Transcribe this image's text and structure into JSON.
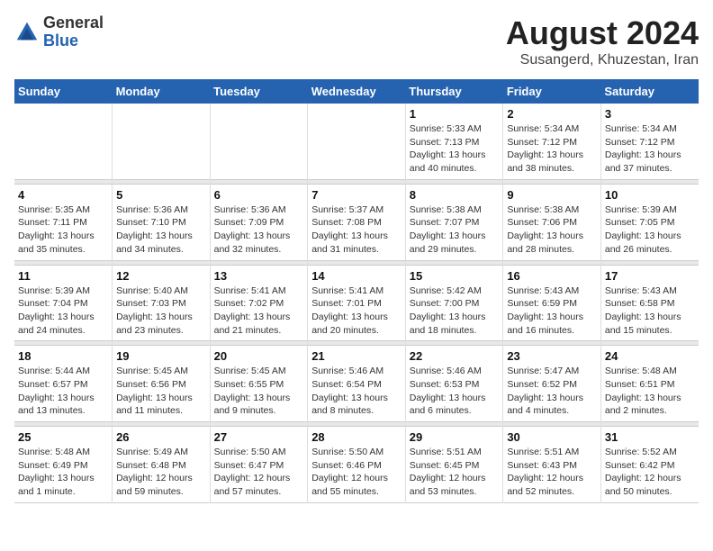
{
  "header": {
    "logo_line1": "General",
    "logo_line2": "Blue",
    "main_title": "August 2024",
    "sub_title": "Susangerd, Khuzestan, Iran"
  },
  "days_of_week": [
    "Sunday",
    "Monday",
    "Tuesday",
    "Wednesday",
    "Thursday",
    "Friday",
    "Saturday"
  ],
  "weeks": [
    {
      "cells": [
        {
          "day": "",
          "info": ""
        },
        {
          "day": "",
          "info": ""
        },
        {
          "day": "",
          "info": ""
        },
        {
          "day": "",
          "info": ""
        },
        {
          "day": "1",
          "info": "Sunrise: 5:33 AM\nSunset: 7:13 PM\nDaylight: 13 hours\nand 40 minutes."
        },
        {
          "day": "2",
          "info": "Sunrise: 5:34 AM\nSunset: 7:12 PM\nDaylight: 13 hours\nand 38 minutes."
        },
        {
          "day": "3",
          "info": "Sunrise: 5:34 AM\nSunset: 7:12 PM\nDaylight: 13 hours\nand 37 minutes."
        }
      ]
    },
    {
      "cells": [
        {
          "day": "4",
          "info": "Sunrise: 5:35 AM\nSunset: 7:11 PM\nDaylight: 13 hours\nand 35 minutes."
        },
        {
          "day": "5",
          "info": "Sunrise: 5:36 AM\nSunset: 7:10 PM\nDaylight: 13 hours\nand 34 minutes."
        },
        {
          "day": "6",
          "info": "Sunrise: 5:36 AM\nSunset: 7:09 PM\nDaylight: 13 hours\nand 32 minutes."
        },
        {
          "day": "7",
          "info": "Sunrise: 5:37 AM\nSunset: 7:08 PM\nDaylight: 13 hours\nand 31 minutes."
        },
        {
          "day": "8",
          "info": "Sunrise: 5:38 AM\nSunset: 7:07 PM\nDaylight: 13 hours\nand 29 minutes."
        },
        {
          "day": "9",
          "info": "Sunrise: 5:38 AM\nSunset: 7:06 PM\nDaylight: 13 hours\nand 28 minutes."
        },
        {
          "day": "10",
          "info": "Sunrise: 5:39 AM\nSunset: 7:05 PM\nDaylight: 13 hours\nand 26 minutes."
        }
      ]
    },
    {
      "cells": [
        {
          "day": "11",
          "info": "Sunrise: 5:39 AM\nSunset: 7:04 PM\nDaylight: 13 hours\nand 24 minutes."
        },
        {
          "day": "12",
          "info": "Sunrise: 5:40 AM\nSunset: 7:03 PM\nDaylight: 13 hours\nand 23 minutes."
        },
        {
          "day": "13",
          "info": "Sunrise: 5:41 AM\nSunset: 7:02 PM\nDaylight: 13 hours\nand 21 minutes."
        },
        {
          "day": "14",
          "info": "Sunrise: 5:41 AM\nSunset: 7:01 PM\nDaylight: 13 hours\nand 20 minutes."
        },
        {
          "day": "15",
          "info": "Sunrise: 5:42 AM\nSunset: 7:00 PM\nDaylight: 13 hours\nand 18 minutes."
        },
        {
          "day": "16",
          "info": "Sunrise: 5:43 AM\nSunset: 6:59 PM\nDaylight: 13 hours\nand 16 minutes."
        },
        {
          "day": "17",
          "info": "Sunrise: 5:43 AM\nSunset: 6:58 PM\nDaylight: 13 hours\nand 15 minutes."
        }
      ]
    },
    {
      "cells": [
        {
          "day": "18",
          "info": "Sunrise: 5:44 AM\nSunset: 6:57 PM\nDaylight: 13 hours\nand 13 minutes."
        },
        {
          "day": "19",
          "info": "Sunrise: 5:45 AM\nSunset: 6:56 PM\nDaylight: 13 hours\nand 11 minutes."
        },
        {
          "day": "20",
          "info": "Sunrise: 5:45 AM\nSunset: 6:55 PM\nDaylight: 13 hours\nand 9 minutes."
        },
        {
          "day": "21",
          "info": "Sunrise: 5:46 AM\nSunset: 6:54 PM\nDaylight: 13 hours\nand 8 minutes."
        },
        {
          "day": "22",
          "info": "Sunrise: 5:46 AM\nSunset: 6:53 PM\nDaylight: 13 hours\nand 6 minutes."
        },
        {
          "day": "23",
          "info": "Sunrise: 5:47 AM\nSunset: 6:52 PM\nDaylight: 13 hours\nand 4 minutes."
        },
        {
          "day": "24",
          "info": "Sunrise: 5:48 AM\nSunset: 6:51 PM\nDaylight: 13 hours\nand 2 minutes."
        }
      ]
    },
    {
      "cells": [
        {
          "day": "25",
          "info": "Sunrise: 5:48 AM\nSunset: 6:49 PM\nDaylight: 13 hours\nand 1 minute."
        },
        {
          "day": "26",
          "info": "Sunrise: 5:49 AM\nSunset: 6:48 PM\nDaylight: 12 hours\nand 59 minutes."
        },
        {
          "day": "27",
          "info": "Sunrise: 5:50 AM\nSunset: 6:47 PM\nDaylight: 12 hours\nand 57 minutes."
        },
        {
          "day": "28",
          "info": "Sunrise: 5:50 AM\nSunset: 6:46 PM\nDaylight: 12 hours\nand 55 minutes."
        },
        {
          "day": "29",
          "info": "Sunrise: 5:51 AM\nSunset: 6:45 PM\nDaylight: 12 hours\nand 53 minutes."
        },
        {
          "day": "30",
          "info": "Sunrise: 5:51 AM\nSunset: 6:43 PM\nDaylight: 12 hours\nand 52 minutes."
        },
        {
          "day": "31",
          "info": "Sunrise: 5:52 AM\nSunset: 6:42 PM\nDaylight: 12 hours\nand 50 minutes."
        }
      ]
    }
  ]
}
